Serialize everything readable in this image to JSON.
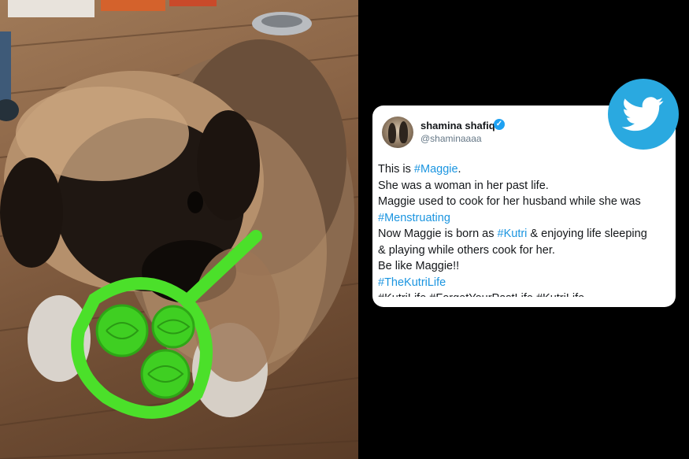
{
  "tweet": {
    "display_name": "shamina shafiq",
    "handle": "@shaminaaaa",
    "lines": [
      {
        "pre": "This is ",
        "tag": "#Maggie",
        "post": "."
      },
      {
        "pre": "She was a woman in her past life.",
        "tag": "",
        "post": ""
      },
      {
        "pre": "Maggie used to cook for her husband while she was",
        "tag": "",
        "post": ""
      },
      {
        "pre": "",
        "tag": "#Menstruating",
        "post": ""
      },
      {
        "pre": "Now Maggie is born as ",
        "tag": "#Kutri",
        "post": " & enjoying life sleeping"
      },
      {
        "pre": "& playing while others cook for her.",
        "tag": "",
        "post": ""
      },
      {
        "pre": "Be like Maggie!!",
        "tag": "",
        "post": ""
      },
      {
        "pre": "",
        "tag": "#TheKutriLife",
        "post": ""
      }
    ],
    "cut_line": "#KutriLife  #ForgetYourPastLife  #KutriLife"
  },
  "colors": {
    "twitter_blue": "#2aa9e0",
    "hashtag": "#1b95e0",
    "toy_green": "#4be02a"
  },
  "icons": {
    "badge": "twitter-bird-icon",
    "verified": "verified-check-icon"
  }
}
